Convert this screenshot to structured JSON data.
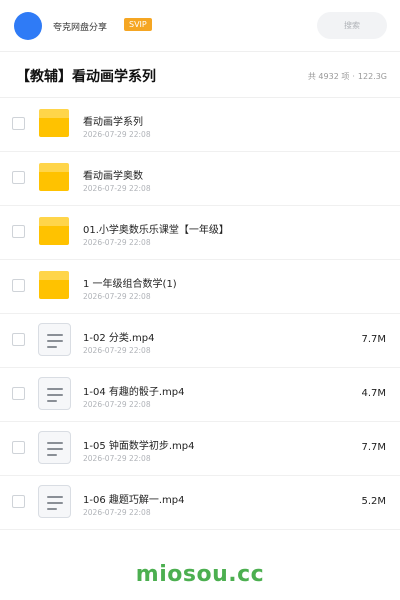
{
  "header": {
    "username": "夸克网盘分享",
    "badge": "SVIP",
    "search_placeholder": "搜索",
    "accent_color": "#2f7bf6"
  },
  "folder": {
    "title": "【教辅】看动画学系列",
    "count": "共 4932 项",
    "separator": "·",
    "total_size": "122.3G"
  },
  "items": [
    {
      "type": "folder",
      "name": "看动画学系列",
      "date": "2026-07-29 22:08",
      "size": ""
    },
    {
      "type": "folder",
      "name": "看动画学奥数",
      "date": "2026-07-29 22:08",
      "size": ""
    },
    {
      "type": "folder",
      "name": "01.小学奥数乐乐课堂【一年级】",
      "date": "2026-07-29 22:08",
      "size": ""
    },
    {
      "type": "folder",
      "name": "1 一年级组合数学(1)",
      "date": "2026-07-29 22:08",
      "size": ""
    },
    {
      "type": "file",
      "name": "1-02 分类.mp4",
      "date": "2026-07-29 22:08",
      "size": "7.7M"
    },
    {
      "type": "file",
      "name": "1-04 有趣的骰子.mp4",
      "date": "2026-07-29 22:08",
      "size": "4.7M"
    },
    {
      "type": "file",
      "name": "1-05 钟面数学初步.mp4",
      "date": "2026-07-29 22:08",
      "size": "7.7M"
    },
    {
      "type": "file",
      "name": "1-06 趣题巧解一.mp4",
      "date": "2026-07-29 22:08",
      "size": "5.2M"
    }
  ],
  "watermark": "miosou.cc"
}
